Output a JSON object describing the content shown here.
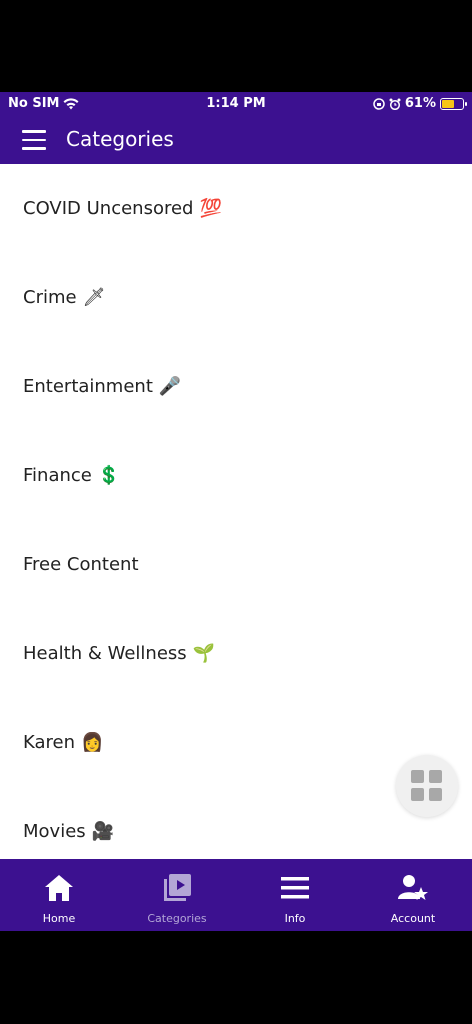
{
  "status_bar": {
    "carrier": "No SIM",
    "time": "1:14 PM",
    "battery": "61%",
    "battery_level": 0.61
  },
  "app_bar": {
    "title": "Categories"
  },
  "categories": [
    {
      "label": "COVID Uncensored",
      "emoji": "💯"
    },
    {
      "label": "Crime",
      "emoji": "🗡"
    },
    {
      "label": "Entertainment",
      "emoji": "🎤"
    },
    {
      "label": "Finance",
      "emoji": "💲"
    },
    {
      "label": "Free Content",
      "emoji": ""
    },
    {
      "label": "Health & Wellness",
      "emoji": "🌱"
    },
    {
      "label": "Karen",
      "emoji": "👩"
    },
    {
      "label": "Movies",
      "emoji": "🎥"
    }
  ],
  "bottom_nav": {
    "home": "Home",
    "categories": "Categories",
    "info": "Info",
    "account": "Account"
  },
  "colors": {
    "brand": "#3c1190",
    "inactive_tab": "#b3a6d6"
  }
}
